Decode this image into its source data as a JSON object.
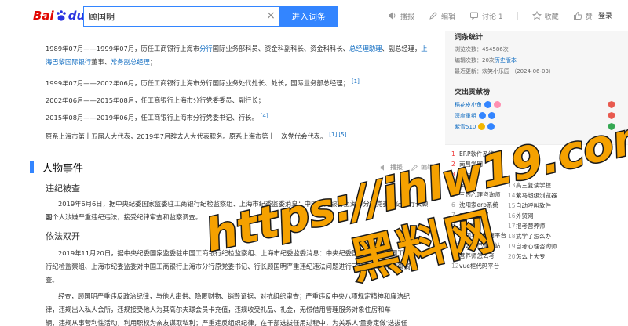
{
  "header": {
    "logo": {
      "bai": "Bai",
      "du": "du",
      "baike": "百科"
    },
    "search_value": "顾国明",
    "enter_button": "进入词条",
    "actions": [
      {
        "icon": "speaker-icon",
        "label": "播报"
      },
      {
        "icon": "pencil-icon",
        "label": "编辑"
      },
      {
        "icon": "comment-icon",
        "label": "讨论 1"
      },
      {
        "icon": "star-icon",
        "label": "收藏"
      },
      {
        "icon": "thumbs-up-icon",
        "label": "赞"
      }
    ],
    "login": "登录"
  },
  "article": {
    "career": [
      {
        "segments": [
          {
            "t": "1989年07月——1999年07月，历任工商银行上海市"
          },
          {
            "t": "分行",
            "link": true
          },
          {
            "t": "国际业务部科员、资金科副科长、资金科科长、"
          },
          {
            "t": "总经理助理",
            "link": true
          },
          {
            "t": "、副总经理，"
          },
          {
            "t": "上海巴黎国际银行",
            "link": true
          },
          {
            "t": "董事、"
          },
          {
            "t": "常务副总经理",
            "link": true
          },
          {
            "t": "；"
          }
        ]
      },
      {
        "segments": [
          {
            "t": "1999年07月——2002年06月，历任工商银行上海市分行国际业务处代处长、处长，国际业务部总经理；"
          }
        ],
        "ref": "[1]"
      },
      {
        "segments": [
          {
            "t": "2002年06月——2015年08月，任工商银行上海市分行党委委员、副行长；"
          }
        ]
      },
      {
        "segments": [
          {
            "t": "2015年08月——2019年06月，任工商银行上海市分行党委书记、行长。"
          }
        ],
        "ref": "[4]"
      },
      {
        "segments": [
          {
            "t": "原系上海市第十五届人大代表，2019年7月辞去人大代表职务。原系上海市第十一次党代会代表。"
          }
        ],
        "ref": "[1] [5]"
      }
    ],
    "section_title": "人物事件",
    "section_actions": {
      "broadcast": "播报",
      "edit": "编辑"
    },
    "sub1_title": "违纪被查",
    "sub1_lines": [
      "2019年6月6日，据中央纪委国家监委驻工商银行纪检监察组、上海市纪委监委消息：中国工商银行上海市分行党委书记、行长顾国",
      "明个人涉嫌严重违纪违法，接受纪律审查和监察调查。"
    ],
    "sub2_title": "依法双开",
    "sub2_lines": [
      "2019年11月20日，据中央纪委国家监委驻中国工商银行纪检监察组、上海市纪委监委消息：中央纪委国家监委驻中国工商银",
      "行纪检监察组、上海市纪委监委对中国工商银行上海市分行原党委书记、行长顾国明严重违纪违法问题进行了纪律审查和监察调",
      "查。"
    ],
    "sub2_more": [
      "经查，顾国明严重违反政治纪律，与他人串供、隐匿财物、销毁证据，对抗组织审查；严重违反中央八项规定精神和廉洁纪",
      "律，违规出入私人会所，违规接受他人为其高尔夫球会员卡充值，违规收受礼品、礼金，无偿借用管理服务对象住房和车",
      "辆，违规从事营利性活动，利用职权为亲友谋取私利；严重违反组织纪律，在干部选拔任用过程中，为关系人'量身定做'选拔任"
    ]
  },
  "sidebar": {
    "stats_title": "词条统计",
    "stats": [
      {
        "label": "浏览次数：",
        "value": "454586次"
      },
      {
        "label": "编辑次数：",
        "value": "20次",
        "link": "历史版本"
      },
      {
        "label": "最近更新：",
        "value": "欢笑小乐园 （2024-06-03）"
      }
    ],
    "contrib_title": "突出贡献榜",
    "contributors": [
      {
        "name": "稻花皮小鱼",
        "tags": [
          "blue",
          "pink"
        ]
      },
      {
        "name": "深度重组",
        "tags": [
          "blue",
          "blue"
        ]
      },
      {
        "name": "紫雪510",
        "tags": [
          "gold",
          "blue"
        ]
      }
    ],
    "hot_list": [
      {
        "rank": "1",
        "title": "ERP软件系统"
      },
      {
        "rank": "2",
        "title": "南昌学网"
      },
      {
        "rank": "3",
        "title": "安装"
      },
      {
        "rank": "4",
        "title": "文案"
      },
      {
        "rank": "5",
        "title": "三线心理咨询师"
      },
      {
        "rank": "6",
        "title": "沈阳家erp系统"
      },
      {
        "rank": "7",
        "title": "中国商业网"
      },
      {
        "rank": "8",
        "title": "外贸网"
      },
      {
        "rank": "9",
        "title": "中国马建网商平台"
      },
      {
        "rank": "10",
        "title": "怎么自己建网站"
      },
      {
        "rank": "11",
        "title": "营养师怎么考"
      },
      {
        "rank": "12",
        "title": "vue框代码平台"
      },
      {
        "rank": "13",
        "title": "高三复读学校"
      },
      {
        "rank": "14",
        "title": "紫马超级浏览器"
      },
      {
        "rank": "15",
        "title": "自动呼叫软件"
      },
      {
        "rank": "16",
        "title": "外贸网"
      },
      {
        "rank": "17",
        "title": "报考营养师"
      },
      {
        "rank": "18",
        "title": "武学了怎么办"
      },
      {
        "rank": "19",
        "title": "自考心理咨询师"
      },
      {
        "rank": "20",
        "title": "怎么上大专"
      }
    ]
  },
  "watermark": {
    "line1": "https://ihlw19.com",
    "line2": "黑料网"
  }
}
